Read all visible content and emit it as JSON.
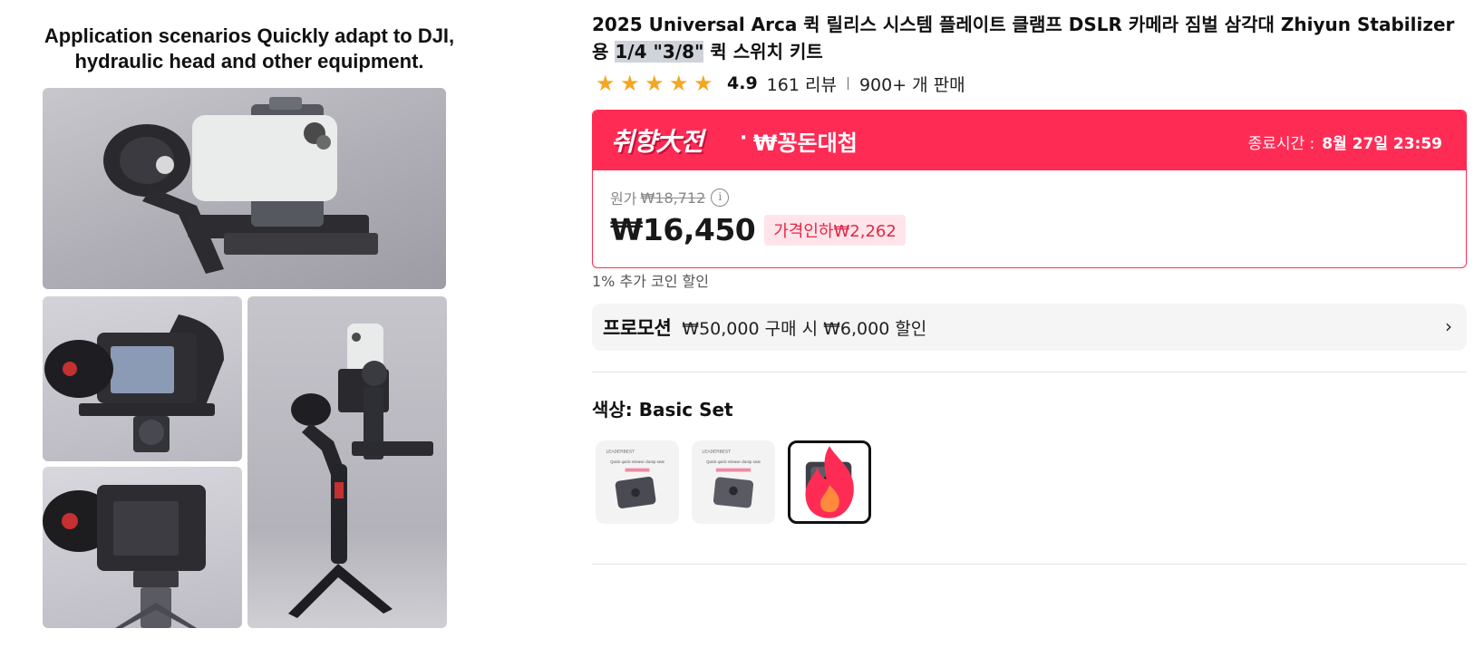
{
  "gallery": {
    "caption_line1": "Application scenarios Quickly adapt to DJI,",
    "caption_line2": "hydraulic head and other equipment.",
    "swatch_brand": "LEADERBEST",
    "swatch1_text": "Quick quick release clamp seat",
    "swatch2_text": "Quick quick release clamp seat"
  },
  "product": {
    "title_part1": "2025 Universal Arca 퀵 릴리스 시스템 플레이트 클램프 DSLR 카메라 짐벌 삼각대 Zhiyun Stabilizer 용 ",
    "title_highlight": "1/4 \"3/8\"",
    "title_part2": " 퀵 스위치 키트"
  },
  "rating": {
    "value": "4.9",
    "stars": 5,
    "reviews": "161 리뷰",
    "sold": "900+ 개 판매"
  },
  "deal": {
    "logo_text": "취향大전",
    "dot": "·",
    "name": "₩꽁돈대첩",
    "end_label": "종료시간 :",
    "end_time": "8월 27일 23:59",
    "original_label": "원가",
    "original_price": "₩18,712",
    "info_icon": "i",
    "price": "₩16,450",
    "discount": "가격인하₩2,262",
    "colors": {
      "accent": "#fe2c55",
      "badge_bg": "#ffe4ea",
      "badge_text": "#e02846"
    }
  },
  "coin_note": "1% 추가 코인 할인",
  "promotion": {
    "label": "프로모션",
    "text": "₩50,000 구매 시 ₩6,000 할인",
    "arrow": "›"
  },
  "color_option": {
    "label": "색상: Basic Set",
    "swatches": [
      {
        "name": "variant-1",
        "selected": false
      },
      {
        "name": "variant-2",
        "selected": false
      },
      {
        "name": "basic-set",
        "selected": true
      }
    ]
  }
}
